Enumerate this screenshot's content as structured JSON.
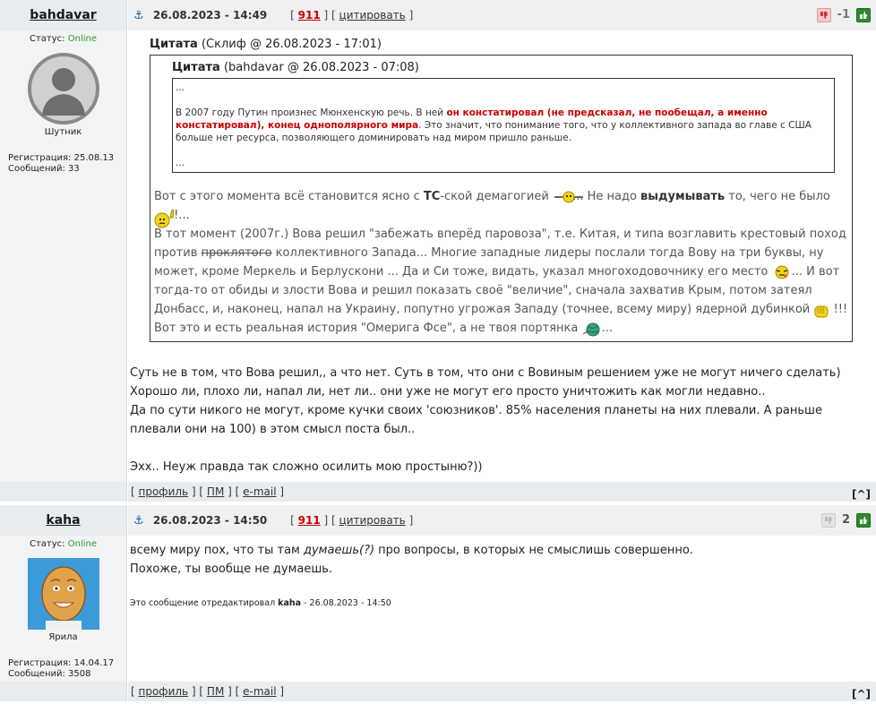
{
  "post1": {
    "author": "bahdavar",
    "datetime": "26.08.2023 - 14:49",
    "post_number": "911",
    "quote_link": "цитировать",
    "rating": "-1",
    "status_label": "Статус:",
    "status_value": "Online",
    "user_title": "Шутник",
    "registration": "Регистрация: 25.08.13",
    "messages": "Сообщений: 33",
    "outer_quote_label": "Цитата",
    "outer_quote_source": "(Склиф @ 26.08.2023 - 17:01)",
    "inner_quote_label": "Цитата",
    "inner_quote_source": "(bahdavar @ 26.08.2023 - 07:08)",
    "inner_dots_top": "...",
    "inner_text_a": "В 2007 году Путин произнес Мюнхенскую речь.  В ней ",
    "inner_text_red": "он констатировал (не предсказал, не пообещал, а именно констатировал), конец однополярного мира",
    "inner_text_b": ".  Это значит, что понимание того, что у коллективного запада во главе с США больше нет ресурса, позволяющего доминировать над миром пришло раньше.",
    "inner_dots_bottom": "...",
    "q_l1_a": "Вот с этого момента всё становится ясно с ",
    "q_l1_b": "ТС",
    "q_l1_c": "-ской демагогией ",
    "q_l1_d": " ... Не надо ",
    "q_l1_e": "выдумывать",
    "q_l1_f": " то, чего не было",
    "q_l2": " !...",
    "q_p2_a": "В тот момент (2007г.) Вова решил \"забежать вперёд паровоза\", т.е. Китая, и типа возглавить крестовый поход против ",
    "q_p2_strike": "проклятого",
    "q_p2_b": " коллективного Запада... Многие западные лидеры послали тогда Вову на три буквы, ну может, кроме Меркель и Берлускони ... Да и Си тоже, видать, указал многоходовочнику его место ",
    "q_p2_c": " ... И вот тогда-то от обиды и злости Вова и решил показать своё \"величие\", сначала захватив Крым, потом затеял Донбасс, и, наконец, напал на Украину, попутно угрожая Западу (точнее, всему миру) ядерной дубинкой ",
    "q_p2_d": " !!!",
    "q_p3_a": "Вот это и есть реальная история \"Омерига Фсе\", а не твоя портянка ",
    "q_p3_b": " ...",
    "own_l1": "Суть не в том, что Вова решил,, а что нет. Суть в том, что они с Вовиным решением уже не могут ничего сделать)",
    "own_l2": "Хорошо ли, плохо ли, напал ли, нет ли.. они уже не могут его просто уничтожить как могли недавно..",
    "own_l3": "Да по сути никого не могут, кроме кучки своих 'союзников'. 85% населения планеты на них плевали. А раньше плевали они на 100) в этом смысл поста был..",
    "own_l4": "Эхх.. Неуж правда так сложно осилить мою простыню?))"
  },
  "post2": {
    "author": "kaha",
    "datetime": "26.08.2023 - 14:50",
    "post_number": "911",
    "quote_link": "цитировать",
    "rating": "2",
    "status_label": "Статус:",
    "status_value": "Online",
    "user_title": "Ярила",
    "registration": "Регистрация: 14.04.17",
    "messages": "Сообщений: 3508",
    "text_a": "всему миру пох, что ты там ",
    "text_em": "думаешь(?)",
    "text_b": " про вопросы, в которых не смыслишь совершенно.",
    "text_l2": "Похоже, ты вообще не думаешь.",
    "edited_a": "Это сообщение отредактировал ",
    "edited_user": "kaha",
    "edited_b": " - 26.08.2023 - 14:50"
  },
  "footer": {
    "profile": "профиль",
    "pm": "ПМ",
    "email": "e-mail",
    "up": "[^]"
  }
}
